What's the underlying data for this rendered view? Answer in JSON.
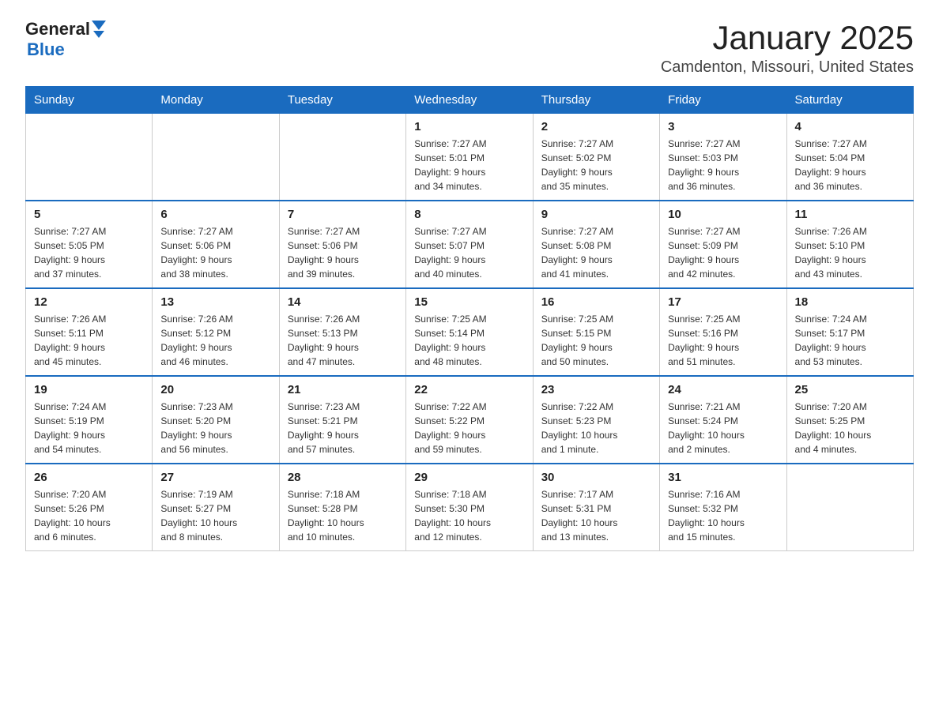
{
  "logo": {
    "general": "General",
    "blue": "Blue"
  },
  "header": {
    "month": "January 2025",
    "location": "Camdenton, Missouri, United States"
  },
  "weekdays": [
    "Sunday",
    "Monday",
    "Tuesday",
    "Wednesday",
    "Thursday",
    "Friday",
    "Saturday"
  ],
  "weeks": [
    [
      {
        "day": "",
        "info": ""
      },
      {
        "day": "",
        "info": ""
      },
      {
        "day": "",
        "info": ""
      },
      {
        "day": "1",
        "info": "Sunrise: 7:27 AM\nSunset: 5:01 PM\nDaylight: 9 hours\nand 34 minutes."
      },
      {
        "day": "2",
        "info": "Sunrise: 7:27 AM\nSunset: 5:02 PM\nDaylight: 9 hours\nand 35 minutes."
      },
      {
        "day": "3",
        "info": "Sunrise: 7:27 AM\nSunset: 5:03 PM\nDaylight: 9 hours\nand 36 minutes."
      },
      {
        "day": "4",
        "info": "Sunrise: 7:27 AM\nSunset: 5:04 PM\nDaylight: 9 hours\nand 36 minutes."
      }
    ],
    [
      {
        "day": "5",
        "info": "Sunrise: 7:27 AM\nSunset: 5:05 PM\nDaylight: 9 hours\nand 37 minutes."
      },
      {
        "day": "6",
        "info": "Sunrise: 7:27 AM\nSunset: 5:06 PM\nDaylight: 9 hours\nand 38 minutes."
      },
      {
        "day": "7",
        "info": "Sunrise: 7:27 AM\nSunset: 5:06 PM\nDaylight: 9 hours\nand 39 minutes."
      },
      {
        "day": "8",
        "info": "Sunrise: 7:27 AM\nSunset: 5:07 PM\nDaylight: 9 hours\nand 40 minutes."
      },
      {
        "day": "9",
        "info": "Sunrise: 7:27 AM\nSunset: 5:08 PM\nDaylight: 9 hours\nand 41 minutes."
      },
      {
        "day": "10",
        "info": "Sunrise: 7:27 AM\nSunset: 5:09 PM\nDaylight: 9 hours\nand 42 minutes."
      },
      {
        "day": "11",
        "info": "Sunrise: 7:26 AM\nSunset: 5:10 PM\nDaylight: 9 hours\nand 43 minutes."
      }
    ],
    [
      {
        "day": "12",
        "info": "Sunrise: 7:26 AM\nSunset: 5:11 PM\nDaylight: 9 hours\nand 45 minutes."
      },
      {
        "day": "13",
        "info": "Sunrise: 7:26 AM\nSunset: 5:12 PM\nDaylight: 9 hours\nand 46 minutes."
      },
      {
        "day": "14",
        "info": "Sunrise: 7:26 AM\nSunset: 5:13 PM\nDaylight: 9 hours\nand 47 minutes."
      },
      {
        "day": "15",
        "info": "Sunrise: 7:25 AM\nSunset: 5:14 PM\nDaylight: 9 hours\nand 48 minutes."
      },
      {
        "day": "16",
        "info": "Sunrise: 7:25 AM\nSunset: 5:15 PM\nDaylight: 9 hours\nand 50 minutes."
      },
      {
        "day": "17",
        "info": "Sunrise: 7:25 AM\nSunset: 5:16 PM\nDaylight: 9 hours\nand 51 minutes."
      },
      {
        "day": "18",
        "info": "Sunrise: 7:24 AM\nSunset: 5:17 PM\nDaylight: 9 hours\nand 53 minutes."
      }
    ],
    [
      {
        "day": "19",
        "info": "Sunrise: 7:24 AM\nSunset: 5:19 PM\nDaylight: 9 hours\nand 54 minutes."
      },
      {
        "day": "20",
        "info": "Sunrise: 7:23 AM\nSunset: 5:20 PM\nDaylight: 9 hours\nand 56 minutes."
      },
      {
        "day": "21",
        "info": "Sunrise: 7:23 AM\nSunset: 5:21 PM\nDaylight: 9 hours\nand 57 minutes."
      },
      {
        "day": "22",
        "info": "Sunrise: 7:22 AM\nSunset: 5:22 PM\nDaylight: 9 hours\nand 59 minutes."
      },
      {
        "day": "23",
        "info": "Sunrise: 7:22 AM\nSunset: 5:23 PM\nDaylight: 10 hours\nand 1 minute."
      },
      {
        "day": "24",
        "info": "Sunrise: 7:21 AM\nSunset: 5:24 PM\nDaylight: 10 hours\nand 2 minutes."
      },
      {
        "day": "25",
        "info": "Sunrise: 7:20 AM\nSunset: 5:25 PM\nDaylight: 10 hours\nand 4 minutes."
      }
    ],
    [
      {
        "day": "26",
        "info": "Sunrise: 7:20 AM\nSunset: 5:26 PM\nDaylight: 10 hours\nand 6 minutes."
      },
      {
        "day": "27",
        "info": "Sunrise: 7:19 AM\nSunset: 5:27 PM\nDaylight: 10 hours\nand 8 minutes."
      },
      {
        "day": "28",
        "info": "Sunrise: 7:18 AM\nSunset: 5:28 PM\nDaylight: 10 hours\nand 10 minutes."
      },
      {
        "day": "29",
        "info": "Sunrise: 7:18 AM\nSunset: 5:30 PM\nDaylight: 10 hours\nand 12 minutes."
      },
      {
        "day": "30",
        "info": "Sunrise: 7:17 AM\nSunset: 5:31 PM\nDaylight: 10 hours\nand 13 minutes."
      },
      {
        "day": "31",
        "info": "Sunrise: 7:16 AM\nSunset: 5:32 PM\nDaylight: 10 hours\nand 15 minutes."
      },
      {
        "day": "",
        "info": ""
      }
    ]
  ]
}
